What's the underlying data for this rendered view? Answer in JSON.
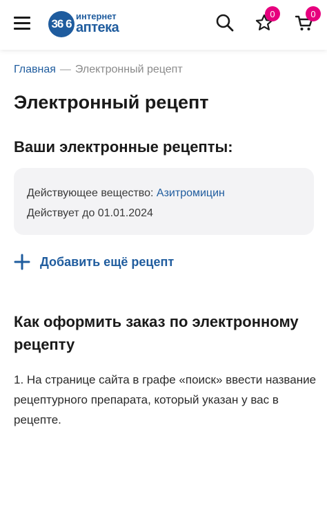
{
  "header": {
    "logo": {
      "number": "36 6",
      "line1": "интернет",
      "line2": "аптека"
    },
    "icons": {
      "menu": "hamburger-menu-icon",
      "search": "search-icon",
      "favorites": "star-icon",
      "cart": "cart-icon"
    },
    "favorites_count": "0",
    "cart_count": "0"
  },
  "breadcrumb": {
    "home": "Главная",
    "separator": "—",
    "current": "Электронный рецепт"
  },
  "page_title": "Электронный рецепт",
  "prescriptions": {
    "title": "Ваши электронные рецепты:",
    "items": [
      {
        "substance_label": "Действующее вещество:",
        "substance_value": "Азитромицин",
        "valid_until": "Действует до 01.01.2024"
      }
    ],
    "add_label": "Добавить ещё рецепт"
  },
  "howto": {
    "title": "Как оформить заказ по электронному рецепту",
    "step1": "1. На странице сайта в графе «поиск» ввести название рецептурного препарата, который указан у вас в рецепте."
  },
  "colors": {
    "brand": "#1f5c9e",
    "badge": "#e6007e",
    "card_bg": "#f3f3f5"
  }
}
